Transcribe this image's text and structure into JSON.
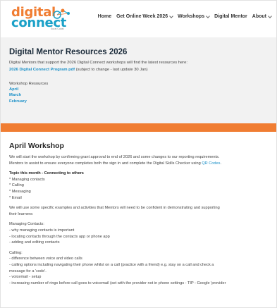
{
  "header": {
    "logo": {
      "line1": "digital",
      "line2": "connect",
      "tagline": "Surat Coast"
    },
    "nav": [
      {
        "label": "Home",
        "dropdown": false
      },
      {
        "label": "Get Online Week 2026",
        "dropdown": true
      },
      {
        "label": "Workshops",
        "dropdown": true
      },
      {
        "label": "Digital Mentor",
        "dropdown": false
      },
      {
        "label": "About",
        "dropdown": true
      }
    ]
  },
  "resources": {
    "title": "Digital Mentor Resources 2026",
    "intro": "Digital Mentors that support the 2026 Digital Connect workshops will find the latest resources here:",
    "program_link": "2026 Digital Connect Program pdf",
    "program_note": " (subject to change - last update 30 Jan)",
    "workshop_label": "Workshop Resources",
    "months": [
      "April",
      "March",
      "February"
    ]
  },
  "workshop": {
    "title": "April Workshop",
    "intro1": "We will start the workshop by confirming grant approval to end of 2026 and some changes to our reporting requirements.",
    "intro2_prefix": "Mentors to assist to ensure everyone completes both the sign in and complete the Digital Skills Checker using ",
    "intro2_link": "QR Codes",
    "intro2_suffix": ".",
    "topic_heading": "Topic this month - Connecting to others",
    "topics": [
      "* Managing contacts",
      "* Calling",
      "* Messaging",
      "* Email"
    ],
    "examples1": "We will use some specific examples and activities that Mentors will need to be confident in demonstrating and supporting",
    "examples2": "their learners:",
    "contacts_heading": "Managing Contacts:",
    "contacts_items": [
      "- why managing contacts is important",
      "- locating contacts through the contacts app or phone app",
      "- adding and editing contacts"
    ],
    "calling_heading": "Calling:",
    "calling_items": [
      "- difference between voice and video calls",
      "- calling options including navigating their phone whilst on a call (practice with a friend) e.g. stay on a call and check a",
      "message for a 'code'.",
      "- voicemail - setup",
      "- increasing number of rings before call goes to voicemail (set with the provider not in phone settings - TIP - Google 'provider"
    ]
  },
  "colors": {
    "orange": "#f07d32",
    "blue": "#1ba1c8",
    "link": "#1b90c8",
    "band": "#f2f2f2"
  }
}
